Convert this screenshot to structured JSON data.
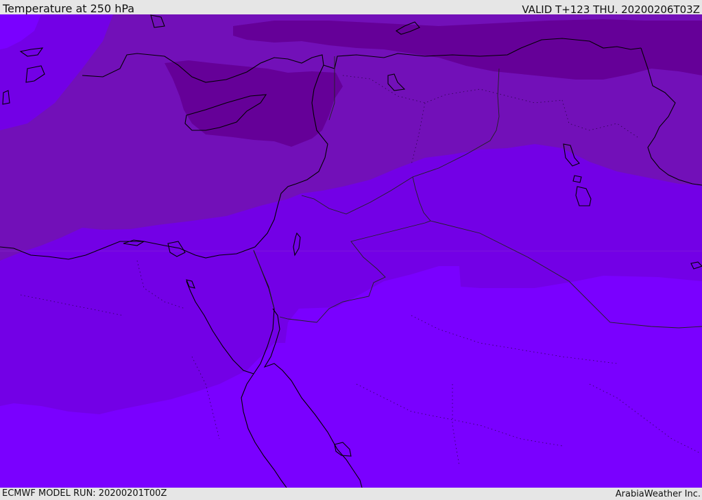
{
  "header": {
    "title": "Temperature at 250 hPa",
    "valid": "VALID T+123 THU. 20200206T03Z"
  },
  "footer": {
    "model_run": "ECMWF MODEL RUN: 20200201T00Z",
    "credit": "ArabiaWeather Inc."
  },
  "map": {
    "field": "Temperature at 250 hPa",
    "colors": {
      "band_warmest": "#7a00ff",
      "band_mid": "#7300e6",
      "band_cool": "#7210b8",
      "band_cold": "#650098",
      "coastline": "#000000",
      "border": "#222222"
    }
  }
}
